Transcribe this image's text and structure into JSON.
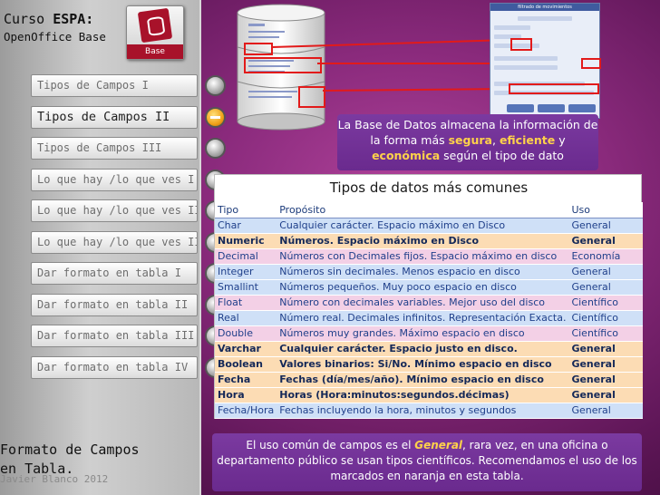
{
  "brand": {
    "course_prefix": "Curso ",
    "course_name": "ESPA:",
    "subtitle": "OpenOffice Base",
    "app_logo_label": "Base"
  },
  "sidebar": {
    "items": [
      {
        "label": "Tipos de Campos I",
        "active": false
      },
      {
        "label": "Tipos de Campos II",
        "active": true
      },
      {
        "label": "Tipos de Campos III",
        "active": false
      },
      {
        "label": "Lo que hay /lo que ves I",
        "active": false
      },
      {
        "label": "Lo que hay /lo que ves II",
        "active": false
      },
      {
        "label": "Lo que hay /lo que ves III",
        "active": false
      },
      {
        "label": "Dar formato en tabla I",
        "active": false
      },
      {
        "label": "Dar formato en tabla II",
        "active": false
      },
      {
        "label": "Dar formato en tabla III",
        "active": false
      },
      {
        "label": "Dar formato en tabla IV",
        "active": false
      }
    ],
    "footer_title_line1": "Formato de Campos",
    "footer_title_line2": "en Tabla.",
    "author": "Javier Blanco 2012"
  },
  "diagram": {
    "form_title": "filtrado de movimientos"
  },
  "callout": {
    "part1": "La Base de Datos almacena la información de la forma más ",
    "w1": "segura",
    "sep1": ", ",
    "w2": "eficiente",
    "part2": " y ",
    "w3": "económica",
    "part3": " según el tipo de dato"
  },
  "table": {
    "title": "Tipos de datos más comunes",
    "headers": [
      "Tipo",
      "Propósito",
      "Uso"
    ],
    "rows": [
      {
        "tipo": "Char",
        "proposito": "Cualquier carácter. Espacio máximo en Disco",
        "uso": "General",
        "style": "blue"
      },
      {
        "tipo": "Numeric",
        "proposito": "Números. Espacio máximo en Disco",
        "uso": "General",
        "style": "orange"
      },
      {
        "tipo": "Decimal",
        "proposito": "Números con Decimales fijos. Espacio máximo en disco",
        "uso": "Economía",
        "style": "pink"
      },
      {
        "tipo": "Integer",
        "proposito": "Números sin decimales. Menos espacio en disco",
        "uso": "General",
        "style": "blue"
      },
      {
        "tipo": "Smallint",
        "proposito": "Números pequeños. Muy poco espacio en disco",
        "uso": "General",
        "style": "blue"
      },
      {
        "tipo": "Float",
        "proposito": "Número con decimales variables. Mejor uso del disco",
        "uso": "Científico",
        "style": "pink"
      },
      {
        "tipo": "Real",
        "proposito": "Número real. Decimales infinitos. Representación Exacta.",
        "uso": "Científico",
        "style": "blue"
      },
      {
        "tipo": "Double",
        "proposito": "Números muy grandes. Máximo espacio en disco",
        "uso": "Científico",
        "style": "pink"
      },
      {
        "tipo": "Varchar",
        "proposito": "Cualquier carácter. Espacio justo en disco.",
        "uso": "General",
        "style": "orange"
      },
      {
        "tipo": "Boolean",
        "proposito": "Valores binarios: Si/No. Mínimo espacio en disco",
        "uso": "General",
        "style": "orange"
      },
      {
        "tipo": "Fecha",
        "proposito": "Fechas (día/mes/año). Mínimo espacio en disco",
        "uso": "General",
        "style": "orange"
      },
      {
        "tipo": "Hora",
        "proposito": "Horas (Hora:minutos:segundos.décimas)",
        "uso": "General",
        "style": "orange"
      },
      {
        "tipo": "Fecha/Hora",
        "proposito": "Fechas incluyendo la hora, minutos y segundos",
        "uso": "General",
        "style": "blue"
      }
    ]
  },
  "note": {
    "part1": "El uso común de campos es el ",
    "emph": "General",
    "part2": ", rara vez, en una oficina o departamento público se usan tipos científicos. Recomendamos el uso de los marcados en naranja en esta tabla."
  },
  "colors": {
    "accent_yellow": "#ffd24a",
    "callout_bg": "#6a2a8e",
    "orange_row": "#fcdcb4",
    "blue_row": "#cfe0f7",
    "pink_row": "#f3d0e6",
    "highlight_red": "#e21a1a"
  }
}
